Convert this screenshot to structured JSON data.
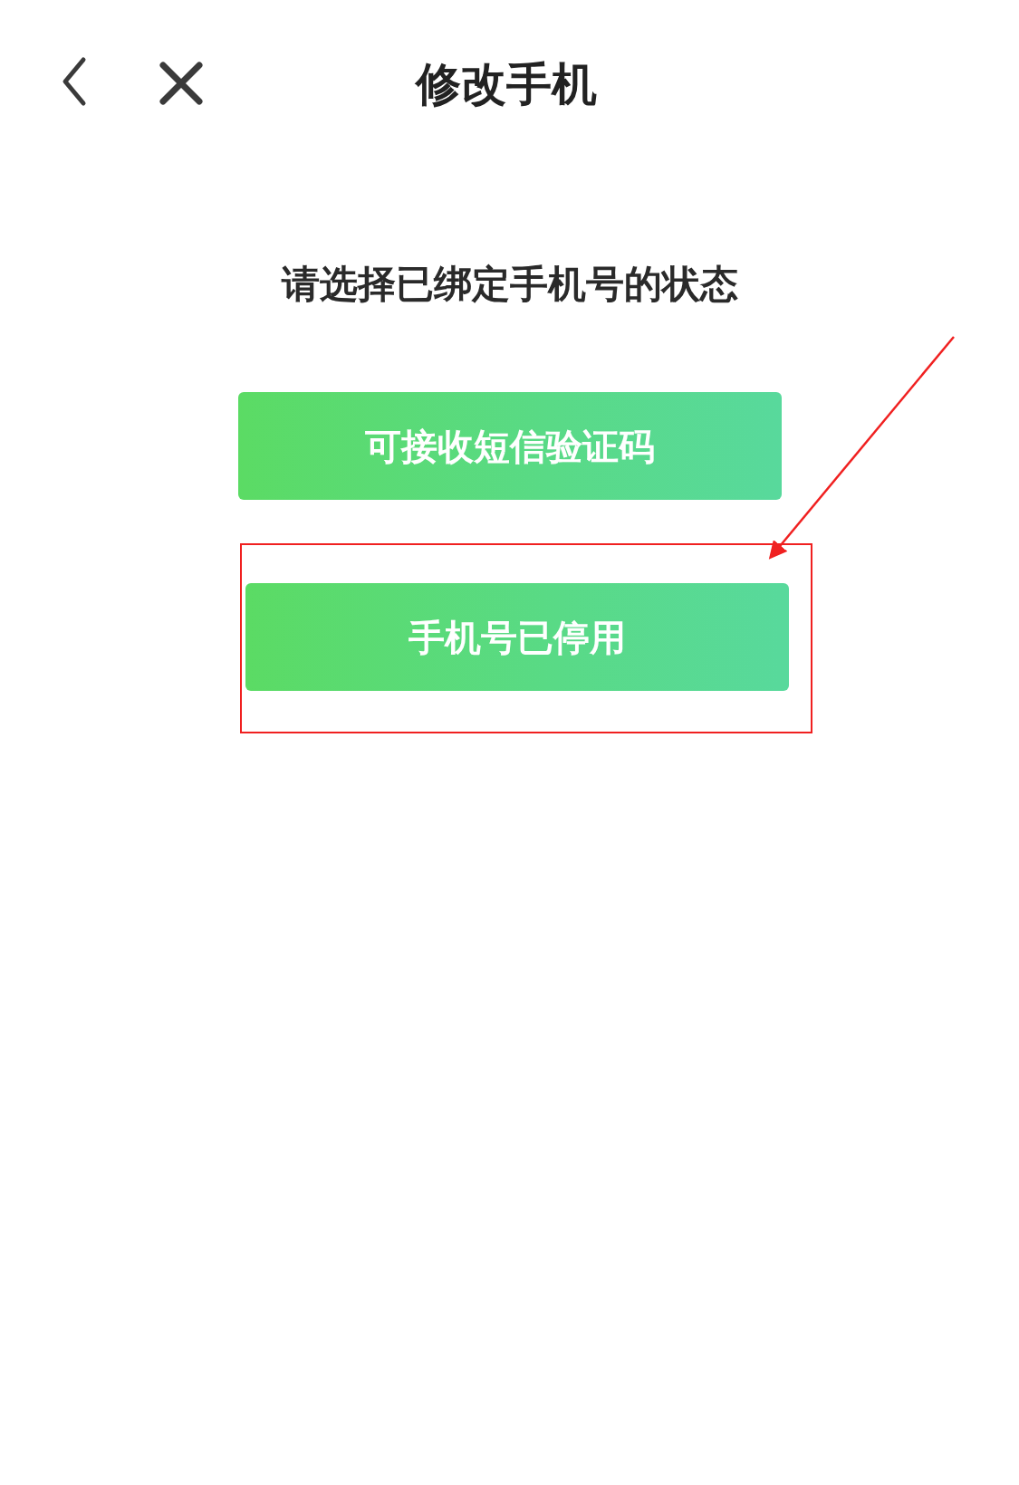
{
  "header": {
    "title": "修改手机"
  },
  "prompt": "请选择已绑定手机号的状态",
  "options": [
    {
      "label": "可接收短信验证码",
      "highlighted": false
    },
    {
      "label": "手机号已停用",
      "highlighted": true
    }
  ]
}
